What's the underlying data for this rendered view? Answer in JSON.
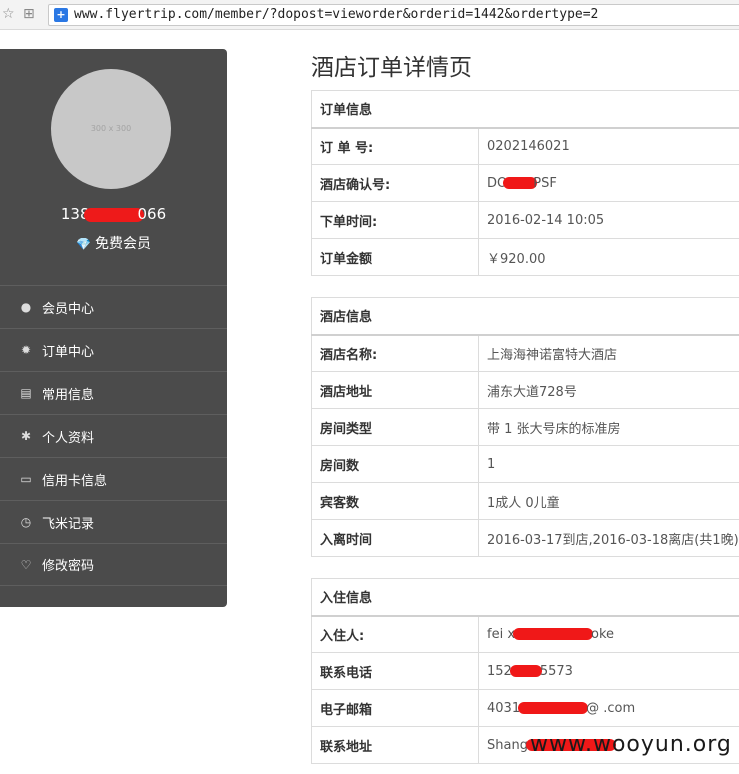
{
  "browser": {
    "url": "www.flyertrip.com/member/?dopost=vieworder&orderid=1442&ordertype=2"
  },
  "profile": {
    "avatar_placeholder": "300 x 300",
    "phone_prefix": "138",
    "phone_suffix": "066",
    "member_level": "免费会员"
  },
  "menu": [
    {
      "label": "会员中心",
      "icon": "user-icon"
    },
    {
      "label": "订单中心",
      "icon": "gear-icon"
    },
    {
      "label": "常用信息",
      "icon": "list-card-icon"
    },
    {
      "label": "个人资料",
      "icon": "asterisk-icon"
    },
    {
      "label": "信用卡信息",
      "icon": "credit-card-icon"
    },
    {
      "label": "飞米记录",
      "icon": "clock-icon"
    },
    {
      "label": "修改密码",
      "icon": "heart-icon"
    }
  ],
  "page": {
    "title": "酒店订单详情页"
  },
  "order_info": {
    "header": "订单信息",
    "rows": [
      {
        "k": "订 单 号:",
        "v": "0202146021"
      },
      {
        "k": "酒店确认号:",
        "v_pre": "DO",
        "v_post": "PSF"
      },
      {
        "k": "下单时间:",
        "v": "2016-02-14 10:05"
      },
      {
        "k": "订单金额",
        "v": "￥920.00"
      }
    ]
  },
  "hotel_info": {
    "header": "酒店信息",
    "rows": [
      {
        "k": "酒店名称:",
        "v": "上海海神诺富特大酒店"
      },
      {
        "k": "酒店地址",
        "v": "浦东大道728号"
      },
      {
        "k": "房间类型",
        "v": "带 1 张大号床的标准房"
      },
      {
        "k": "房间数",
        "v": "1"
      },
      {
        "k": "宾客数",
        "v": "1成人 0儿童"
      },
      {
        "k": "入离时间",
        "v": "2016-03-17到店,2016-03-18离店(共1晚)"
      }
    ]
  },
  "checkin_info": {
    "header": "入住信息",
    "rows": [
      {
        "k": "入住人:",
        "v_pre": "fei x",
        "v_post": "oke"
      },
      {
        "k": "联系电话",
        "v_pre": "152",
        "v_post": "5573"
      },
      {
        "k": "电子邮箱",
        "v_pre": "4031",
        "v_post": "@     .com"
      },
      {
        "k": "联系地址",
        "v_pre": "Shang",
        "v_post": ""
      }
    ]
  },
  "watermark": "www.wooyun.org"
}
